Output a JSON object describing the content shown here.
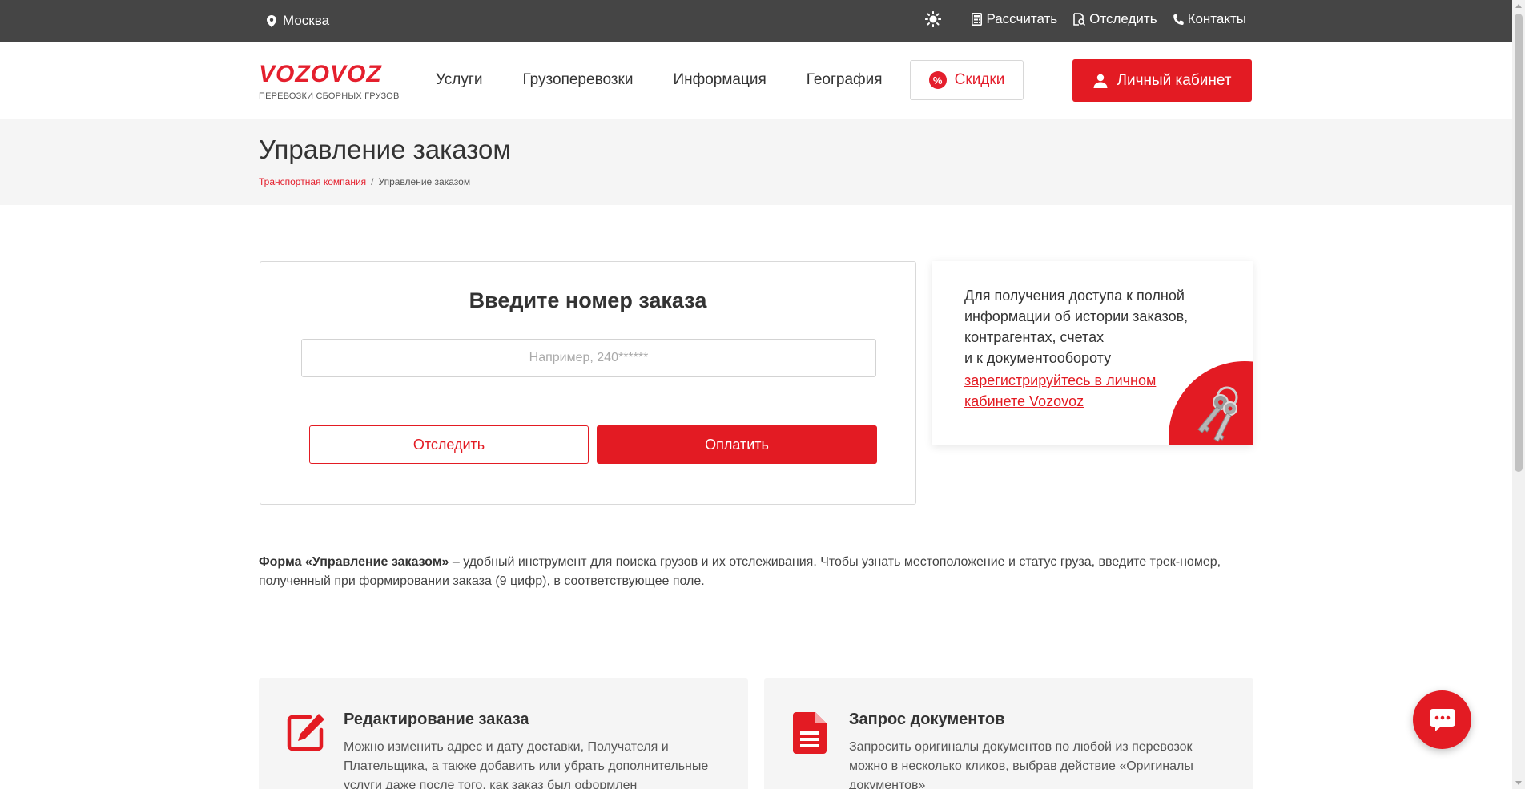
{
  "topbar": {
    "city": "Москва",
    "links": {
      "calculate": "Рассчитать",
      "track": "Отследить",
      "contacts": "Контакты"
    }
  },
  "header": {
    "logo_word": "VOZOVOZ",
    "logo_tagline": "ПЕРЕВОЗКИ СБОРНЫХ ГРУЗОВ",
    "nav": {
      "services": "Услуги",
      "freight": "Грузоперевозки",
      "info": "Информация",
      "geo": "География"
    },
    "discount_label": "Скидки",
    "discount_badge": "%",
    "cabinet_label": "Личный кабинет"
  },
  "page": {
    "title": "Управление заказом",
    "breadcrumb": {
      "home": "Транспортная компания",
      "separator": "/",
      "current": "Управление заказом"
    }
  },
  "order_form": {
    "heading": "Введите номер заказа",
    "placeholder": "Например, 240******",
    "value": "",
    "track_label": "Отследить",
    "pay_label": "Оплатить"
  },
  "info_card": {
    "text_1": "Для получения доступа к полной информации об истории заказов, контрагентах, счетах",
    "text_2": "и к документообороту",
    "register_link": "зарегистрируйтесь в личном кабинете Vozovoz"
  },
  "description": {
    "lead_bold": "Форма «Управление заказом»",
    "text": " – удобный инструмент для поиска грузов и их отслеживания. Чтобы узнать местоположение и статус груза, введите трек-номер, полученный при формировании заказа (9 цифр), в соответствующее поле."
  },
  "features": [
    {
      "icon": "edit-icon",
      "title": "Редактирование заказа",
      "text": "Можно изменить адрес и дату доставки, Получателя и Плательщика, а также добавить или убрать дополнительные услуги даже после того, как заказ был оформлен"
    },
    {
      "icon": "document-icon",
      "title": "Запрос документов",
      "text": "Запросить оригиналы документов по любой из перевозок можно в несколько кликов, выбрав действие «Оригиналы документов»"
    }
  ],
  "colors": {
    "brand_red": "#e31b23",
    "topbar_bg": "#454545",
    "band_bg": "#f5f5f5"
  }
}
